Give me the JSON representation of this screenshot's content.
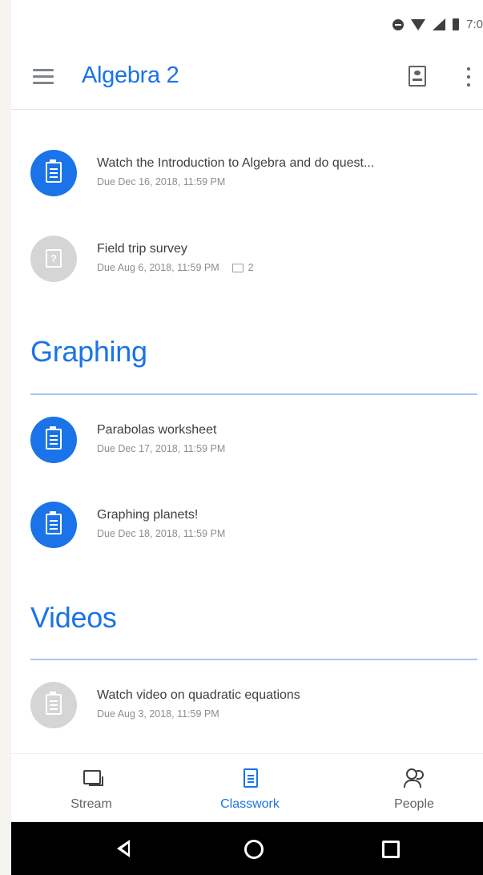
{
  "status_bar": {
    "time": "7:0"
  },
  "app_bar": {
    "title": "Algebra 2"
  },
  "top_items": [
    {
      "title": "Watch the Introduction to Algebra and do quest...",
      "due": "Due Dec 16, 2018, 11:59 PM",
      "icon": "assignment-icon"
    },
    {
      "title": "Field trip survey",
      "due": "Due Aug 6, 2018, 11:59 PM",
      "comments": "2",
      "icon": "question-icon"
    }
  ],
  "sections": [
    {
      "title": "Graphing",
      "items": [
        {
          "title": "Parabolas worksheet",
          "due": "Due Dec 17, 2018, 11:59 PM",
          "icon": "assignment-icon"
        },
        {
          "title": "Graphing planets!",
          "due": "Due Dec 18, 2018, 11:59 PM",
          "icon": "assignment-icon"
        }
      ]
    },
    {
      "title": "Videos",
      "items": [
        {
          "title": "Watch video on quadratic equations",
          "due": "Due Aug 3, 2018, 11:59 PM",
          "icon": "assignment-icon"
        }
      ]
    }
  ],
  "bottom_nav": {
    "tabs": [
      {
        "label": "Stream",
        "icon": "stream-icon"
      },
      {
        "label": "Classwork",
        "icon": "classwork-icon",
        "active": true
      },
      {
        "label": "People",
        "icon": "people-icon"
      }
    ]
  },
  "colors": {
    "accent": "#1a73e8",
    "inactive_icon": "#d5d5d5",
    "divider": "#a8c4f5"
  }
}
